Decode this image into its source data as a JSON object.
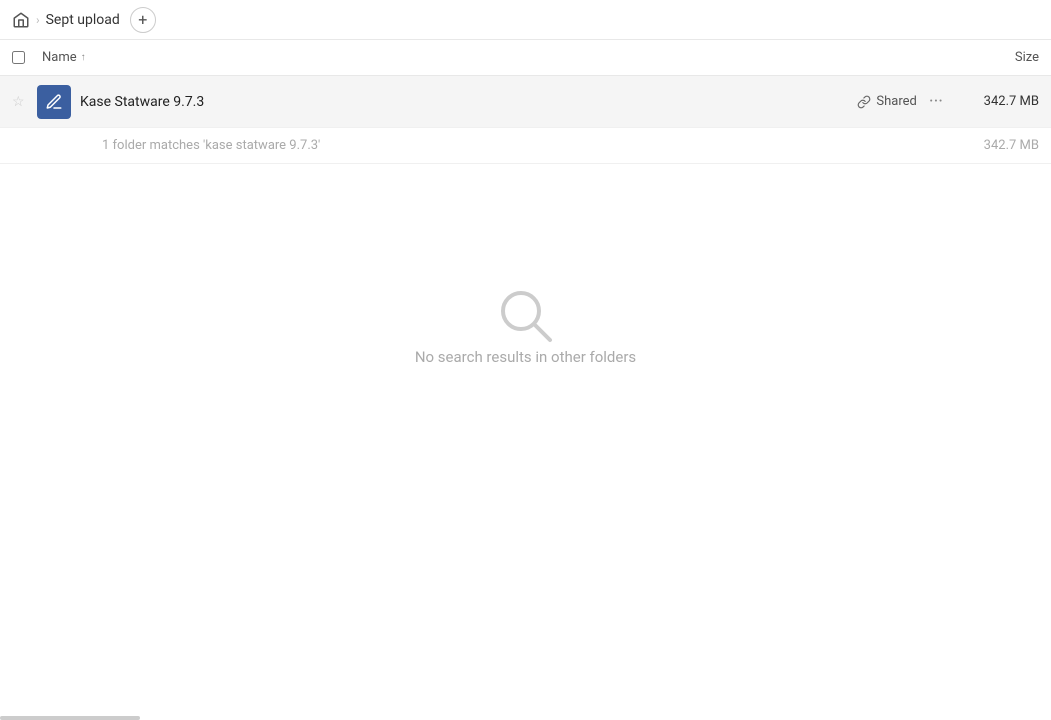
{
  "breadcrumb": {
    "home_icon": "🏠",
    "separator": ">",
    "current": "Sept upload",
    "add_button_label": "+"
  },
  "columns": {
    "name_label": "Name",
    "size_label": "Size",
    "sort_indicator": "↑"
  },
  "file_row": {
    "star_icon": "☆",
    "folder_name": "Kase Statware 9.7.3",
    "shared_label": "Shared",
    "more_icon": "···",
    "size": "342.7 MB",
    "link_icon": "🔗"
  },
  "match_info": {
    "text": "1 folder matches 'kase statware 9.7.3'",
    "size": "342.7 MB"
  },
  "empty_state": {
    "message": "No search results in other folders"
  }
}
